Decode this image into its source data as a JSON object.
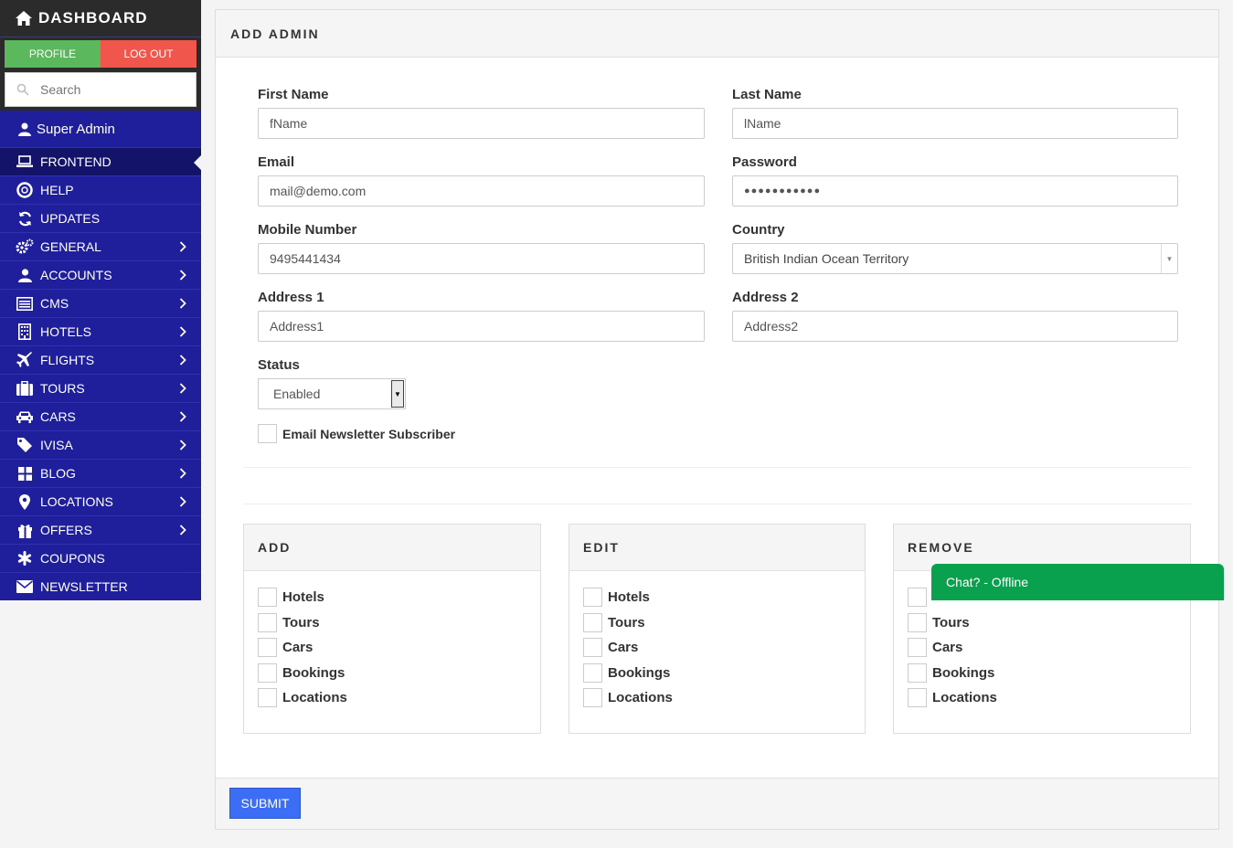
{
  "sidebar": {
    "brand": "DASHBOARD",
    "profile_label": "PROFILE",
    "logout_label": "LOG OUT",
    "search_placeholder": "Search",
    "user_name": "Super Admin",
    "items": [
      {
        "label": "FRONTEND",
        "icon": "laptop-icon",
        "chevron": false,
        "active": true
      },
      {
        "label": "HELP",
        "icon": "lifebuoy-icon",
        "chevron": false
      },
      {
        "label": "UPDATES",
        "icon": "refresh-icon",
        "chevron": false
      },
      {
        "label": "GENERAL",
        "icon": "gears-icon",
        "chevron": true
      },
      {
        "label": "ACCOUNTS",
        "icon": "user-icon",
        "chevron": true
      },
      {
        "label": "CMS",
        "icon": "list-icon",
        "chevron": true
      },
      {
        "label": "HOTELS",
        "icon": "building-icon",
        "chevron": true
      },
      {
        "label": "FLIGHTS",
        "icon": "plane-icon",
        "chevron": true
      },
      {
        "label": "TOURS",
        "icon": "suitcase-icon",
        "chevron": true
      },
      {
        "label": "CARS",
        "icon": "car-icon",
        "chevron": true
      },
      {
        "label": "IVISA",
        "icon": "tag-icon",
        "chevron": true
      },
      {
        "label": "BLOG",
        "icon": "grid-icon",
        "chevron": true
      },
      {
        "label": "LOCATIONS",
        "icon": "map-marker-icon",
        "chevron": true
      },
      {
        "label": "OFFERS",
        "icon": "gift-icon",
        "chevron": true
      },
      {
        "label": "COUPONS",
        "icon": "asterisk-icon",
        "chevron": false
      },
      {
        "label": "NEWSLETTER",
        "icon": "envelope-icon",
        "chevron": false
      }
    ]
  },
  "form": {
    "title": "ADD ADMIN",
    "first_name": {
      "label": "First Name",
      "value": "fName"
    },
    "last_name": {
      "label": "Last Name",
      "value": "lName"
    },
    "email": {
      "label": "Email",
      "value": "mail@demo.com"
    },
    "password": {
      "label": "Password",
      "value": "●●●●●●●●●●●"
    },
    "mobile": {
      "label": "Mobile Number",
      "value": "9495441434"
    },
    "country": {
      "label": "Country",
      "value": "British Indian Ocean Territory"
    },
    "address1": {
      "label": "Address 1",
      "value": "Address1"
    },
    "address2": {
      "label": "Address 2",
      "value": "Address2"
    },
    "status": {
      "label": "Status",
      "value": "Enabled"
    },
    "newsletter_label": "Email Newsletter Subscriber",
    "submit_label": "SUBMIT"
  },
  "permissions": {
    "add": {
      "title": "ADD",
      "items": [
        "Hotels",
        "Tours",
        "Cars",
        "Bookings",
        "Locations"
      ]
    },
    "edit": {
      "title": "EDIT",
      "items": [
        "Hotels",
        "Tours",
        "Cars",
        "Bookings",
        "Locations"
      ]
    },
    "remove": {
      "title": "REMOVE",
      "items": [
        "Tours",
        "Cars",
        "Bookings",
        "Locations"
      ]
    }
  },
  "chat": {
    "label": "Chat? - Offline"
  },
  "colors": {
    "sidebar": "#1f1f9c",
    "profile": "#5cb85c",
    "logout": "#f0564c",
    "submit": "#3b6ef5",
    "chat": "#0aa14e"
  }
}
